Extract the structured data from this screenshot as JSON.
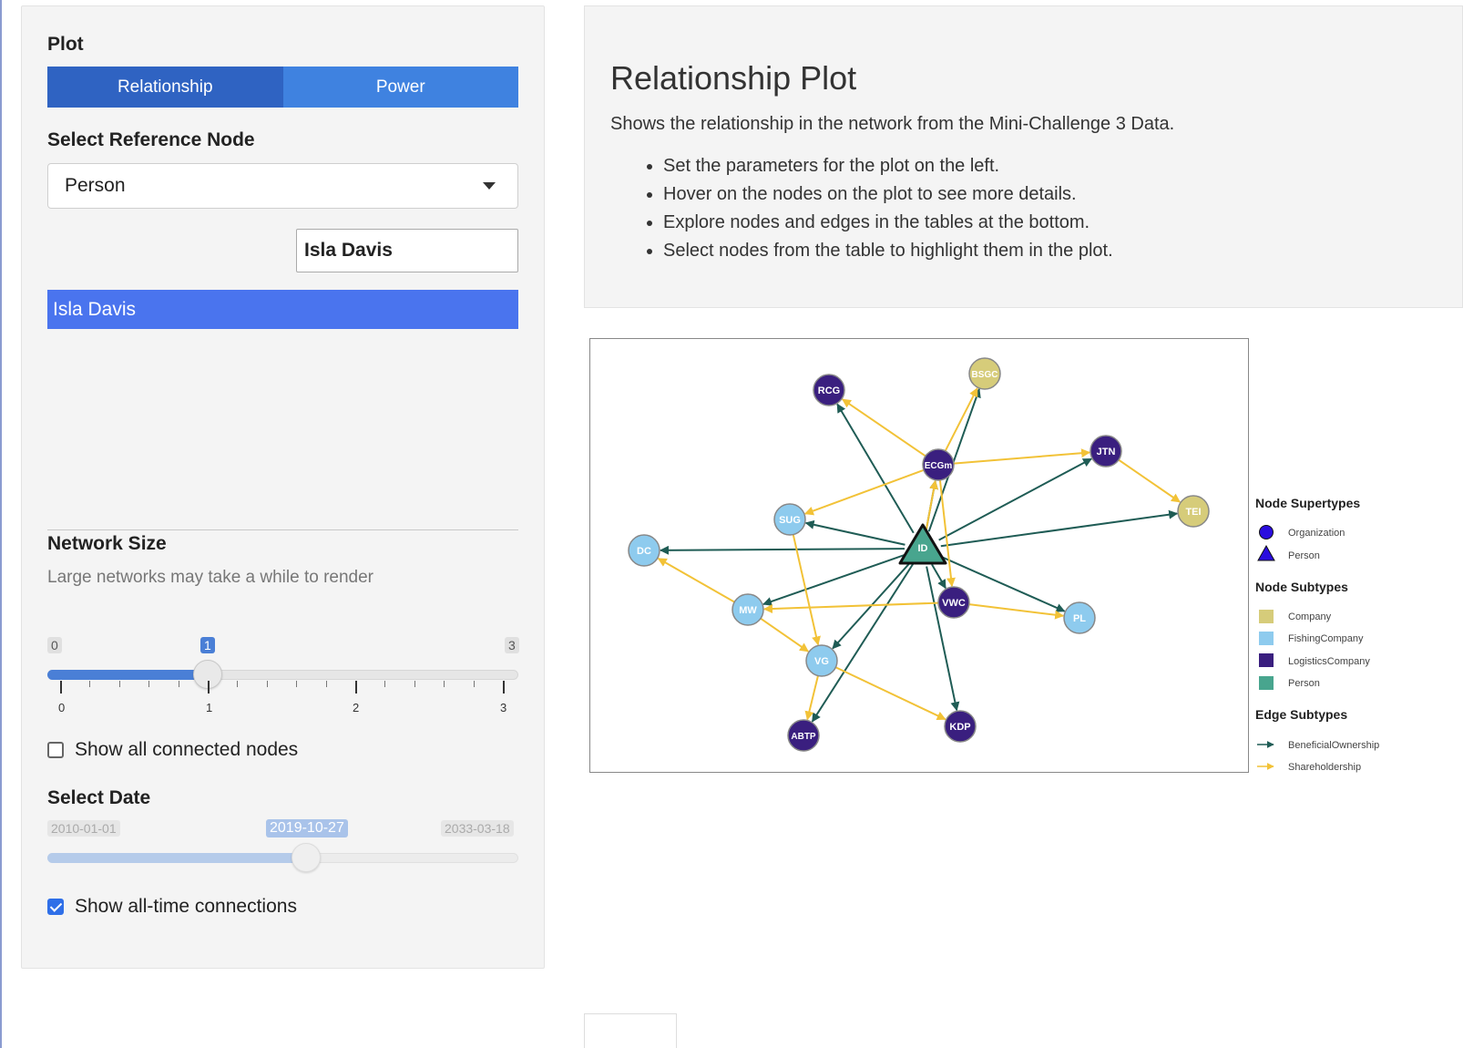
{
  "sidebar": {
    "plot_label": "Plot",
    "tabs": [
      {
        "label": "Relationship",
        "active": true
      },
      {
        "label": "Power",
        "active": false
      }
    ],
    "ref_node_label": "Select Reference Node",
    "ref_node_value": "Person",
    "search_value": "Isla Davis",
    "selected_item": "Isla Davis",
    "network_size_label": "Network Size",
    "network_size_help": "Large networks may take a while to render",
    "size_slider": {
      "min": "0",
      "max": "3",
      "value": "1",
      "fraction": 0.333,
      "ticks": [
        "0",
        "1",
        "2",
        "3"
      ]
    },
    "show_all_connected": {
      "label": "Show all connected nodes",
      "checked": false
    },
    "date_label": "Select Date",
    "date_slider": {
      "min": "2010-01-01",
      "max": "2033-03-18",
      "value": "2019-10-27",
      "fraction": 0.55
    },
    "show_all_time": {
      "label": "Show all-time connections",
      "checked": true
    }
  },
  "main": {
    "title": "Relationship Plot",
    "description": "Shows the relationship in the network from the Mini-Challenge 3 Data.",
    "bullets": [
      "Set the parameters for the plot on the left.",
      "Hover on the nodes on the plot to see more details.",
      "Explore nodes and edges in the tables at the bottom.",
      "Select nodes from the table to highlight them in the plot."
    ]
  },
  "graph": {
    "colors": {
      "Company": "#d6cc7a",
      "FishingCompany": "#8ecbee",
      "LogisticsCompany": "#3a1f7f",
      "Person": "#48a58e",
      "BeneficialOwnership": "#1f5c55",
      "Shareholdership": "#f2c237"
    },
    "nodes": [
      {
        "id": "ID",
        "subtype": "Person",
        "shape": "triangle"
      },
      {
        "id": "RCG",
        "subtype": "LogisticsCompany"
      },
      {
        "id": "BSGC",
        "subtype": "Company"
      },
      {
        "id": "ECGm",
        "subtype": "LogisticsCompany"
      },
      {
        "id": "JTN",
        "subtype": "LogisticsCompany"
      },
      {
        "id": "TEI",
        "subtype": "Company"
      },
      {
        "id": "SUG",
        "subtype": "FishingCompany"
      },
      {
        "id": "DC",
        "subtype": "FishingCompany"
      },
      {
        "id": "MW",
        "subtype": "FishingCompany"
      },
      {
        "id": "VWC",
        "subtype": "LogisticsCompany"
      },
      {
        "id": "PL",
        "subtype": "FishingCompany"
      },
      {
        "id": "VG",
        "subtype": "FishingCompany"
      },
      {
        "id": "ABTP",
        "subtype": "LogisticsCompany"
      },
      {
        "id": "KDP",
        "subtype": "LogisticsCompany"
      }
    ],
    "edges": [
      {
        "from": "ID",
        "to": "RCG",
        "type": "BeneficialOwnership"
      },
      {
        "from": "ID",
        "to": "BSGC",
        "type": "BeneficialOwnership"
      },
      {
        "from": "ID",
        "to": "ECGm",
        "type": "BeneficialOwnership"
      },
      {
        "from": "ID",
        "to": "JTN",
        "type": "BeneficialOwnership"
      },
      {
        "from": "ID",
        "to": "TEI",
        "type": "BeneficialOwnership"
      },
      {
        "from": "ID",
        "to": "SUG",
        "type": "BeneficialOwnership"
      },
      {
        "from": "ID",
        "to": "DC",
        "type": "BeneficialOwnership"
      },
      {
        "from": "ID",
        "to": "MW",
        "type": "BeneficialOwnership"
      },
      {
        "from": "ID",
        "to": "VWC",
        "type": "BeneficialOwnership"
      },
      {
        "from": "ID",
        "to": "PL",
        "type": "BeneficialOwnership"
      },
      {
        "from": "ID",
        "to": "VG",
        "type": "BeneficialOwnership"
      },
      {
        "from": "ID",
        "to": "ABTP",
        "type": "BeneficialOwnership"
      },
      {
        "from": "ID",
        "to": "KDP",
        "type": "BeneficialOwnership"
      },
      {
        "from": "ECGm",
        "to": "RCG",
        "type": "Shareholdership"
      },
      {
        "from": "ECGm",
        "to": "BSGC",
        "type": "Shareholdership"
      },
      {
        "from": "ECGm",
        "to": "JTN",
        "type": "Shareholdership"
      },
      {
        "from": "ECGm",
        "to": "SUG",
        "type": "Shareholdership"
      },
      {
        "from": "ECGm",
        "to": "VWC",
        "type": "Shareholdership"
      },
      {
        "from": "ID",
        "to": "ECGm",
        "type": "Shareholdership"
      },
      {
        "from": "JTN",
        "to": "TEI",
        "type": "Shareholdership"
      },
      {
        "from": "MW",
        "to": "DC",
        "type": "Shareholdership"
      },
      {
        "from": "VWC",
        "to": "MW",
        "type": "Shareholdership"
      },
      {
        "from": "VWC",
        "to": "PL",
        "type": "Shareholdership"
      },
      {
        "from": "SUG",
        "to": "VG",
        "type": "Shareholdership"
      },
      {
        "from": "MW",
        "to": "VG",
        "type": "Shareholdership"
      },
      {
        "from": "VG",
        "to": "ABTP",
        "type": "Shareholdership"
      },
      {
        "from": "VG",
        "to": "KDP",
        "type": "Shareholdership"
      }
    ]
  },
  "legend": {
    "supertypes_title": "Node  Supertypes",
    "supertypes": [
      "Organization",
      "Person"
    ],
    "node_subtypes_title": "Node  Subtypes",
    "node_subtypes": [
      "Company",
      "FishingCompany",
      "LogisticsCompany",
      "Person"
    ],
    "edge_subtypes_title": "Edge  Subtypes",
    "edge_subtypes": [
      "BeneficialOwnership",
      "Shareholdership"
    ]
  }
}
